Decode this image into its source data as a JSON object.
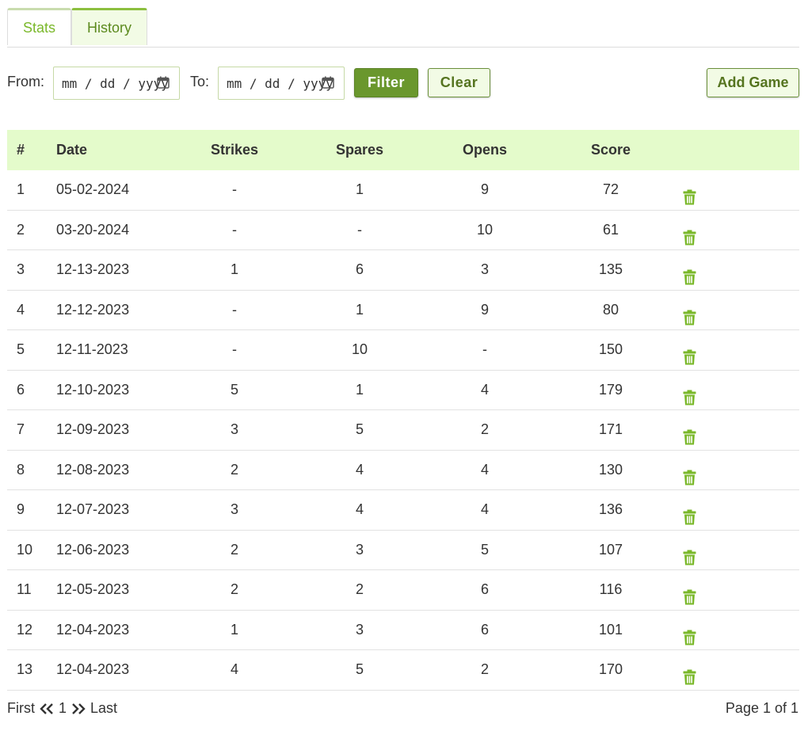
{
  "tabs": [
    {
      "label": "Stats",
      "active": false
    },
    {
      "label": "History",
      "active": true
    }
  ],
  "filter": {
    "from_label": "From:",
    "to_label": "To:",
    "from_placeholder": "mm / dd / yyyy",
    "to_placeholder": "mm / dd / yyyy",
    "filter_label": "Filter",
    "clear_label": "Clear",
    "add_label": "Add Game"
  },
  "table": {
    "headers": {
      "num": "#",
      "date": "Date",
      "strikes": "Strikes",
      "spares": "Spares",
      "opens": "Opens",
      "score": "Score"
    },
    "rows": [
      {
        "num": "1",
        "date": "05-02-2024",
        "strikes": "-",
        "spares": "1",
        "opens": "9",
        "score": "72"
      },
      {
        "num": "2",
        "date": "03-20-2024",
        "strikes": "-",
        "spares": "-",
        "opens": "10",
        "score": "61"
      },
      {
        "num": "3",
        "date": "12-13-2023",
        "strikes": "1",
        "spares": "6",
        "opens": "3",
        "score": "135"
      },
      {
        "num": "4",
        "date": "12-12-2023",
        "strikes": "-",
        "spares": "1",
        "opens": "9",
        "score": "80"
      },
      {
        "num": "5",
        "date": "12-11-2023",
        "strikes": "-",
        "spares": "10",
        "opens": "-",
        "score": "150"
      },
      {
        "num": "6",
        "date": "12-10-2023",
        "strikes": "5",
        "spares": "1",
        "opens": "4",
        "score": "179"
      },
      {
        "num": "7",
        "date": "12-09-2023",
        "strikes": "3",
        "spares": "5",
        "opens": "2",
        "score": "171"
      },
      {
        "num": "8",
        "date": "12-08-2023",
        "strikes": "2",
        "spares": "4",
        "opens": "4",
        "score": "130"
      },
      {
        "num": "9",
        "date": "12-07-2023",
        "strikes": "3",
        "spares": "4",
        "opens": "4",
        "score": "136"
      },
      {
        "num": "10",
        "date": "12-06-2023",
        "strikes": "2",
        "spares": "3",
        "opens": "5",
        "score": "107"
      },
      {
        "num": "11",
        "date": "12-05-2023",
        "strikes": "2",
        "spares": "2",
        "opens": "6",
        "score": "116"
      },
      {
        "num": "12",
        "date": "12-04-2023",
        "strikes": "1",
        "spares": "3",
        "opens": "6",
        "score": "101"
      },
      {
        "num": "13",
        "date": "12-04-2023",
        "strikes": "4",
        "spares": "5",
        "opens": "2",
        "score": "170"
      }
    ]
  },
  "pager": {
    "first": "First",
    "current": "1",
    "last": "Last",
    "page_info": "Page 1 of 1"
  },
  "colors": {
    "accent": "#6a972d",
    "header_bg": "#e4fbcb",
    "trash": "#7ab82a"
  },
  "icons": {
    "calendar": "calendar-icon",
    "delete": "trash-icon",
    "prev": "double-chevron-left-icon",
    "next": "double-chevron-right-icon"
  }
}
